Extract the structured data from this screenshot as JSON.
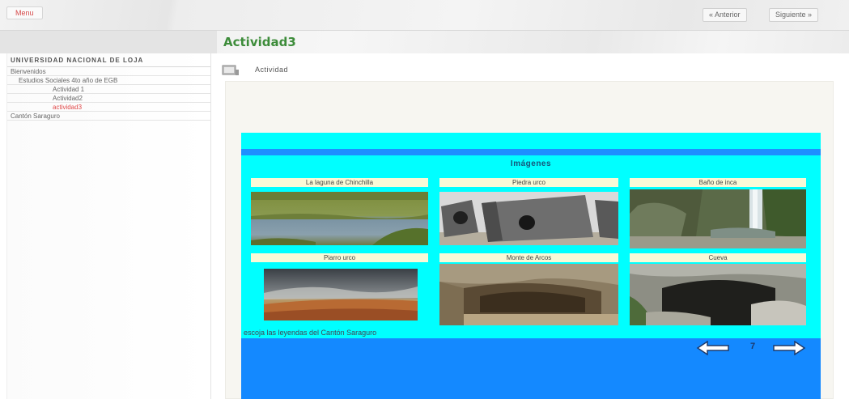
{
  "topbar": {
    "menu_label": "Menu",
    "prev_label": "« Anterior",
    "next_label": "Siguiente »"
  },
  "page": {
    "title": "Actividad3",
    "activity_label": "Actividad"
  },
  "sidebar": {
    "heading": "Universidad Nacional de Loja",
    "items": [
      {
        "label": "Bienvenidos",
        "level": 0
      },
      {
        "label": "Estudios Sociales 4to año de EGB",
        "level": 1
      },
      {
        "label": "Actividad 1",
        "level": 2
      },
      {
        "label": "Actividad2",
        "level": 2
      },
      {
        "label": "actividad3",
        "level": 2,
        "active": true
      },
      {
        "label": "Cantón Saraguro",
        "level": 0
      }
    ]
  },
  "gallery": {
    "title": "Imágenes",
    "captions": [
      "La laguna de Chinchilla",
      "Piedra urco",
      "Baño de inca",
      "Piarro urco",
      "Monte de Arcos",
      "Cueva"
    ],
    "footer_text": "escoja las leyendas del Cantón Saraguro",
    "page_number": "7",
    "colors": {
      "background": "#00ffff",
      "stripe": "#1e8fff",
      "bottom": "#1489ff",
      "caption_bg": "#fafad7"
    }
  },
  "theme": {
    "title_color": "#3d8c3a",
    "menu_color": "#d64a4a",
    "active_color": "#e04848"
  }
}
